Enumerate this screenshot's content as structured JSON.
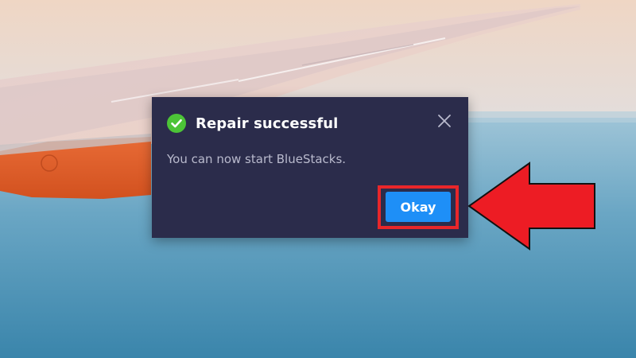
{
  "dialog": {
    "title": "Repair successful",
    "message": "You can now start BlueStacks.",
    "okay_label": "Okay",
    "icons": {
      "status": "check-circle-icon",
      "close": "close-icon"
    }
  },
  "annotation": {
    "highlight_color": "#e8262a",
    "arrow_color": "#ed1c24",
    "arrow_direction": "left"
  },
  "colors": {
    "dialog_bg": "#2b2c4b",
    "primary_button": "#1e8ff7",
    "success": "#4cc437"
  }
}
